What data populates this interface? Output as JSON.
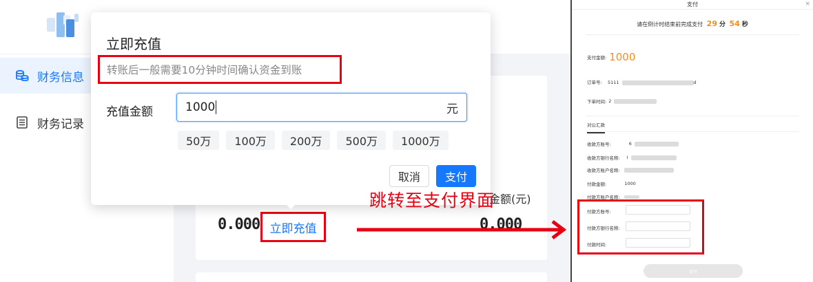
{
  "sidebar": {
    "items": [
      {
        "label": "财务信息",
        "icon": "coins-icon",
        "active": true
      },
      {
        "label": "财务记录",
        "icon": "list-icon",
        "active": false
      }
    ]
  },
  "main": {
    "balance_left": "0.000",
    "balance_right": "0.000",
    "balance_label": "点金额(元)",
    "recharge_link": "立即充值"
  },
  "modal": {
    "title": "立即充值",
    "tip": "转账后一般需要10分钟时间确认资金到账",
    "amount_label": "充值金额",
    "amount_value": "1000",
    "amount_unit": "元",
    "presets": [
      "50万",
      "100万",
      "200万",
      "500万",
      "1000万"
    ],
    "cancel_label": "取消",
    "pay_label": "支付"
  },
  "annotation": {
    "text": "跳转至支付界面",
    "color": "#e60012"
  },
  "payment": {
    "title": "支付",
    "close": "×",
    "countdown_prefix": "请在倒计时结束前完成支付",
    "minutes": "29",
    "minutes_unit": "分",
    "seconds": "54",
    "seconds_unit": "秒",
    "amount_label": "支付金额:",
    "amount_value": "1000",
    "order_label": "订单号:",
    "order_prefix": "5111",
    "order_suffix": "d",
    "time_label": "下单时间:",
    "time_prefix": "2",
    "tab_label": "对公汇款",
    "receiver_account_label": "收款方账号:",
    "receiver_account_prefix": "6",
    "receiver_bank_label": "收款方银行名称:",
    "receiver_bank_prefix": "I",
    "receiver_name_label": "收款方账户名称:",
    "pay_amount_label": "付款金额:",
    "pay_amount_value": "1000",
    "payer_name_label": "付款方账户名称:",
    "payer_account_label": "付款方账号:",
    "payer_bank_label": "付款方银行名称:",
    "pay_time_label": "付款时间:",
    "submit_label": "支付"
  },
  "colors": {
    "accent": "#1677ff",
    "highlight": "#e60012",
    "orange": "#fa8c16"
  }
}
